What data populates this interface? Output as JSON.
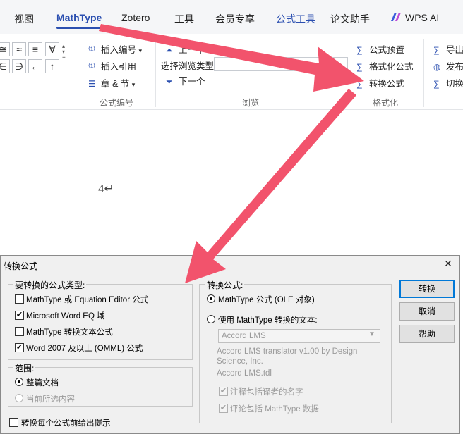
{
  "tabs": [
    "视图",
    "MathType",
    "Zotero",
    "工具",
    "会员专享",
    "公式工具",
    "论文助手",
    "WPS AI"
  ],
  "ribbon": {
    "symbols_row1": [
      "≅",
      "≈",
      "≡",
      "∀"
    ],
    "symbols_row2": [
      "∈",
      "∋",
      "←",
      "↑"
    ],
    "equation_numbers": {
      "insert_number": "插入编号",
      "insert_reference": "插入引用",
      "chapter_section": "章 & 节",
      "group_label": "公式编号"
    },
    "browse": {
      "up": "上一个",
      "select_type": "选择浏览类型",
      "next": "下一个",
      "group_label": "浏览"
    },
    "format": {
      "preset": "公式预置",
      "format_equations": "格式化公式",
      "convert_equations": "转换公式",
      "group_label": "格式化"
    },
    "publish": {
      "export": "导出",
      "publish": "发布",
      "toggle": "切换"
    }
  },
  "document": {
    "paragraph_number": "4↵"
  },
  "dialog": {
    "title": "转换公式",
    "close": "✕",
    "types_group": {
      "legend": "要转换的公式类型:",
      "options": [
        {
          "label": "MathType 或 Equation Editor 公式",
          "checked": false
        },
        {
          "label": "Microsoft Word EQ 域",
          "checked": true
        },
        {
          "label": "MathType 转换文本公式",
          "checked": false
        },
        {
          "label": "Word 2007 及以上 (OMML) 公式",
          "checked": true
        }
      ]
    },
    "range_group": {
      "legend": "范围:",
      "whole_doc": "整篇文档",
      "current_selection": "当前所选内容"
    },
    "prompt_checkbox": "转换每个公式前给出提示",
    "convert_to_group": {
      "legend": "转换公式:",
      "ole_option": "MathType 公式 (OLE 对象)",
      "text_option": "使用 MathType 转换的文本:",
      "translator_select": "Accord LMS",
      "translator_desc": "Accord LMS translator v1.00 by Design Science, Inc.",
      "translator_file": "Accord LMS.tdl",
      "include_name": "注释包括译者的名字",
      "include_data": "评论包括 MathType 数据"
    },
    "buttons": {
      "convert": "转换",
      "cancel": "取消",
      "help": "帮助"
    }
  }
}
